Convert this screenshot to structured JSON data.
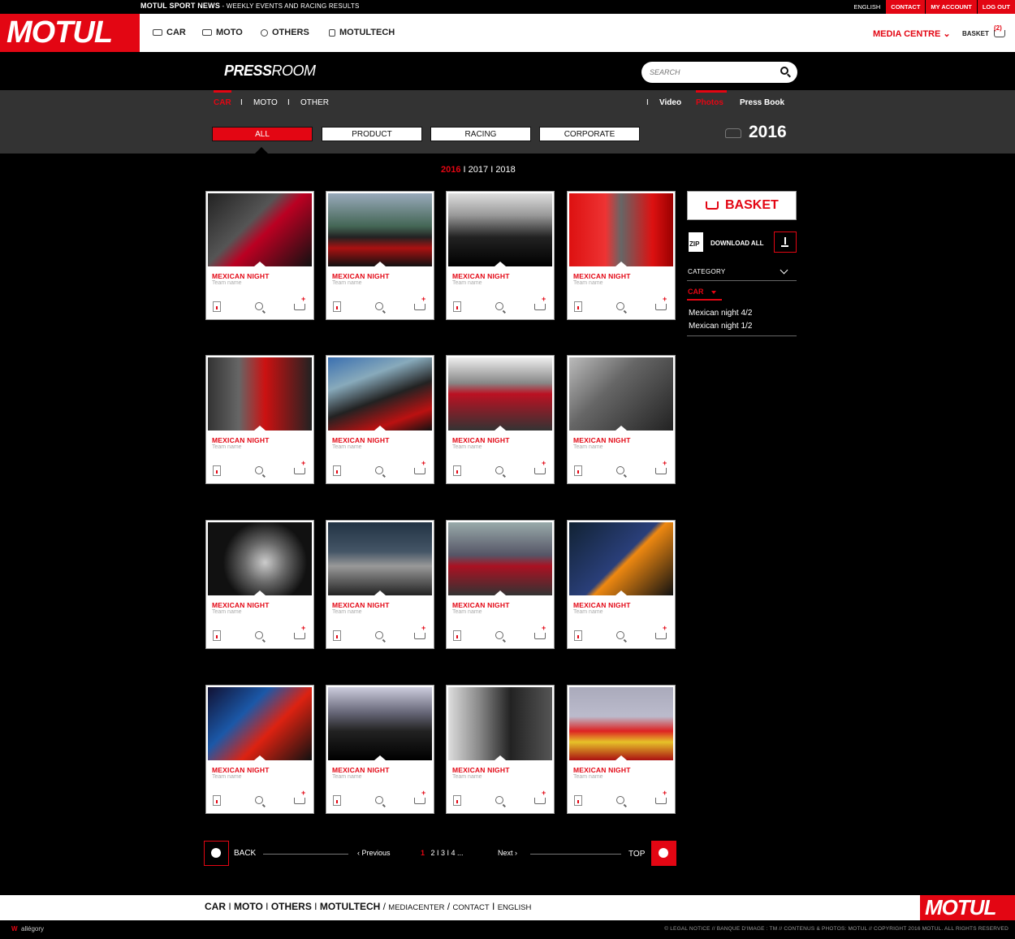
{
  "topbar": {
    "news_title": "MOTUL SPORT NEWS",
    "news_sub": " - WEEKLY EVENTS AND RACING RESULTS",
    "links": [
      "ENGLISH",
      "CONTACT",
      "MY ACCOUNT",
      "LOG OUT"
    ]
  },
  "brand": {
    "logo": "MOTUL"
  },
  "mainnav": {
    "items": [
      "CAR",
      "MOTO",
      "OTHERS",
      "MOTULTECH"
    ],
    "media_centre": "MEDIA CENTRE",
    "basket": "BASKET",
    "basket_count": "(2)"
  },
  "pressroom": {
    "title_bold": "PRESS",
    "title_light": "ROOM",
    "search_placeholder": "SEARCH"
  },
  "subtabs": [
    "CAR",
    "MOTO",
    "OTHER"
  ],
  "mediatabs": [
    "Video",
    "Photos",
    "Press Book"
  ],
  "filters": [
    "ALL",
    "PRODUCT",
    "RACING",
    "CORPORATE"
  ],
  "year_title": "2016",
  "years": {
    "current": "2016",
    "others": [
      "2017",
      "2018"
    ]
  },
  "cards": [
    {
      "title": "MEXICAN NIGHT",
      "team": "Team name"
    },
    {
      "title": "MEXICAN NIGHT",
      "team": "Team name"
    },
    {
      "title": "MEXICAN NIGHT",
      "team": "Team name"
    },
    {
      "title": "MEXICAN NIGHT",
      "team": "Team name"
    },
    {
      "title": "MEXICAN NIGHT",
      "team": "Team name"
    },
    {
      "title": "MEXICAN NIGHT",
      "team": "Team name"
    },
    {
      "title": "MEXICAN NIGHT",
      "team": "Team name"
    },
    {
      "title": "MEXICAN NIGHT",
      "team": "Team name"
    },
    {
      "title": "MEXICAN NIGHT",
      "team": "Team name"
    },
    {
      "title": "MEXICAN NIGHT",
      "team": "Team name"
    },
    {
      "title": "MEXICAN NIGHT",
      "team": "Team name"
    },
    {
      "title": "MEXICAN NIGHT",
      "team": "Team name"
    },
    {
      "title": "MEXICAN NIGHT",
      "team": "Team name"
    },
    {
      "title": "MEXICAN NIGHT",
      "team": "Team name"
    },
    {
      "title": "MEXICAN NIGHT",
      "team": "Team name"
    },
    {
      "title": "MEXICAN NIGHT",
      "team": "Team name"
    }
  ],
  "sidebar": {
    "basket": "BASKET",
    "zip": "ZIP",
    "download_all": "DOWNLOAD ALL",
    "category": "CATEGORY",
    "car": "CAR",
    "items": [
      "Mexican night 4/2",
      "Mexican night 1/2"
    ]
  },
  "pager": {
    "back": "BACK",
    "previous": "Previous",
    "current": "1",
    "pages": "2 I 3 I 4 ...",
    "next": "Next",
    "top": "TOP"
  },
  "footer": {
    "nav_bold": [
      "CAR",
      "MOTO",
      "OTHERS",
      "MOTULTECH"
    ],
    "nav_small": [
      "MEDIACENTER",
      "CONTACT",
      "ENGLISH"
    ],
    "logo": "MOTUL",
    "agency": "allégory",
    "legal": "© LEGAL NOTICE // BANQUE D'IMAGE : TM // CONTENUS & PHOTOS: MOTUL // COPYRIGHT 2016 MOTUL. ALL RIGHTS RESERVED"
  },
  "colors": {
    "accent": "#e30613",
    "background": "#000000",
    "band": "#333333"
  }
}
